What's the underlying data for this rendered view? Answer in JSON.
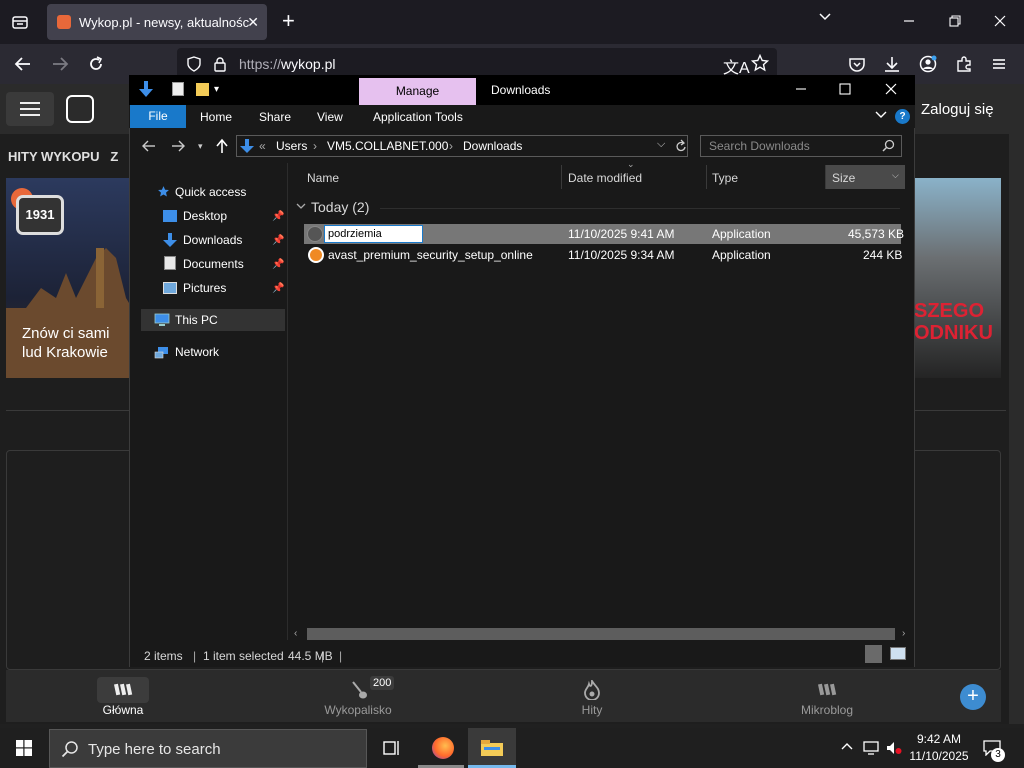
{
  "browser": {
    "tab_title": "Wykop.pl - newsy, aktualności, g",
    "url_scheme": "https://",
    "url_host": "wykop.pl"
  },
  "wykop": {
    "login": "Zaloguj się",
    "hity_label": "HITY WYKOPU",
    "hity_extra": "Z",
    "card_left_badge": "1931",
    "card_left_text": "Znów ci sami lud Krakowie",
    "card_right_text": "SZEGO\nODNIKU",
    "bottom_nav": [
      {
        "label": "Główna",
        "icon": "home-icon"
      },
      {
        "label": "Wykopalisko",
        "icon": "shovel-icon",
        "count": "200"
      },
      {
        "label": "Hity",
        "icon": "fire-icon"
      },
      {
        "label": "Mikroblog",
        "icon": "microblog-icon"
      }
    ]
  },
  "explorer": {
    "title": "Downloads",
    "manage": "Manage",
    "ribbon_tabs": [
      "File",
      "Home",
      "Share",
      "View",
      "Application Tools"
    ],
    "breadcrumb": [
      "Users",
      "VM5.COLLABNET.000",
      "Downloads"
    ],
    "search_placeholder": "Search Downloads",
    "nav": {
      "quick_access": "Quick access",
      "items": [
        "Desktop",
        "Downloads",
        "Documents",
        "Pictures"
      ],
      "this_pc": "This PC",
      "network": "Network"
    },
    "columns": [
      "Name",
      "Date modified",
      "Type",
      "Size"
    ],
    "group": "Today (2)",
    "files": [
      {
        "name": "podrziemia",
        "date": "11/10/2025 9:41 AM",
        "type": "Application",
        "size": "45,573 KB"
      },
      {
        "name": "avast_premium_security_setup_online",
        "date": "11/10/2025 9:34 AM",
        "type": "Application",
        "size": "244 KB"
      }
    ],
    "status": {
      "items": "2 items",
      "selected": "1 item selected",
      "size": "44.5 MB"
    }
  },
  "taskbar": {
    "search_placeholder": "Type here to search",
    "time": "9:42 AM",
    "date": "11/10/2025",
    "notif_count": "3"
  }
}
